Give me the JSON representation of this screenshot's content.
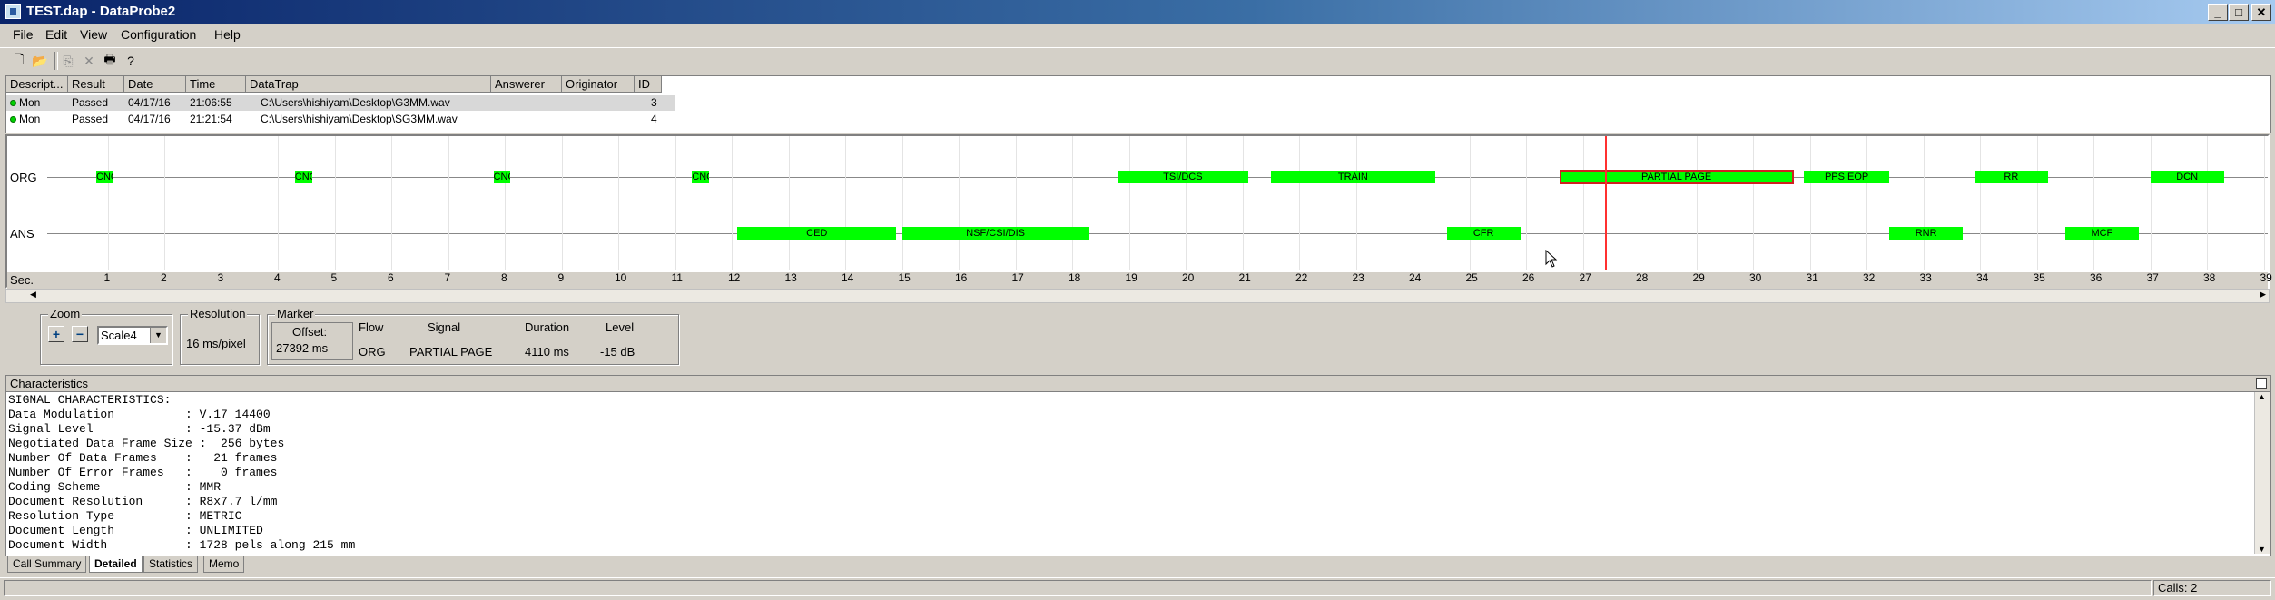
{
  "window": {
    "title": "TEST.dap - DataProbe2"
  },
  "menu": [
    "File",
    "Edit",
    "View",
    "Configuration",
    "Help"
  ],
  "calls": {
    "columns": [
      "Descript...",
      "Result",
      "Date",
      "Time",
      "DataTrap",
      "Answerer",
      "Originator",
      "ID"
    ],
    "rows": [
      {
        "descript": "Mon",
        "result": "Passed",
        "date": "04/17/16",
        "time": "21:06:55",
        "datatrap": "C:\\Users\\hishiyam\\Desktop\\G3MM.wav",
        "answerer": "",
        "originator": "",
        "id": "3"
      },
      {
        "descript": "Mon",
        "result": "Passed",
        "date": "04/17/16",
        "time": "21:21:54",
        "datatrap": "C:\\Users\\hishiyam\\Desktop\\SG3MM.wav",
        "answerer": "",
        "originator": "",
        "id": "4"
      }
    ]
  },
  "timeline": {
    "row_labels": {
      "org": "ORG",
      "ans": "ANS",
      "sec": "Sec."
    },
    "seconds": [
      "1",
      "2",
      "3",
      "4",
      "5",
      "6",
      "7",
      "8",
      "9",
      "10",
      "11",
      "12",
      "13",
      "14",
      "15",
      "16",
      "17",
      "18",
      "19",
      "20",
      "21",
      "22",
      "23",
      "24",
      "25",
      "26",
      "27",
      "28",
      "29",
      "30",
      "31",
      "32",
      "33",
      "34",
      "35",
      "36",
      "37",
      "38",
      "39"
    ],
    "org_signals": [
      "CNG",
      "CNG",
      "CNG",
      "CNG",
      "TSI/DCS",
      "TRAIN",
      "PARTIAL PAGE",
      "PPS EOP",
      "RR",
      "DCN"
    ],
    "ans_signals": [
      "CED",
      "NSF/CSI/DIS",
      "CFR",
      "RNR",
      "MCF"
    ],
    "marker_seconds": 27.392
  },
  "controls": {
    "zoom_label": "Zoom",
    "scale_value": "Scale4",
    "resolution_label": "Resolution",
    "resolution_value": "16 ms/pixel",
    "marker_label": "Marker",
    "offset_label": "Offset:",
    "offset_value": "27392 ms",
    "headers": {
      "flow": "Flow",
      "signal": "Signal",
      "duration": "Duration",
      "level": "Level"
    },
    "values": {
      "flow": "ORG",
      "signal": "PARTIAL PAGE",
      "duration": "4110 ms",
      "level": "-15 dB"
    }
  },
  "characteristics": {
    "title": "Characteristics",
    "lines": [
      "SIGNAL CHARACTERISTICS:",
      "Data Modulation          : V.17 14400",
      "Signal Level             : -15.37 dBm",
      "Negotiated Data Frame Size :  256 bytes",
      "Number Of Data Frames    :   21 frames",
      "Number Of Error Frames   :    0 frames",
      "Coding Scheme            : MMR",
      "Document Resolution      : R8x7.7 l/mm",
      "Resolution Type          : METRIC",
      "Document Length          : UNLIMITED",
      "Document Width           : 1728 pels along 215 mm"
    ]
  },
  "tabs": [
    "Call Summary",
    "Detailed",
    "Statistics",
    "Memo"
  ],
  "status": {
    "calls": "Calls: 2"
  }
}
